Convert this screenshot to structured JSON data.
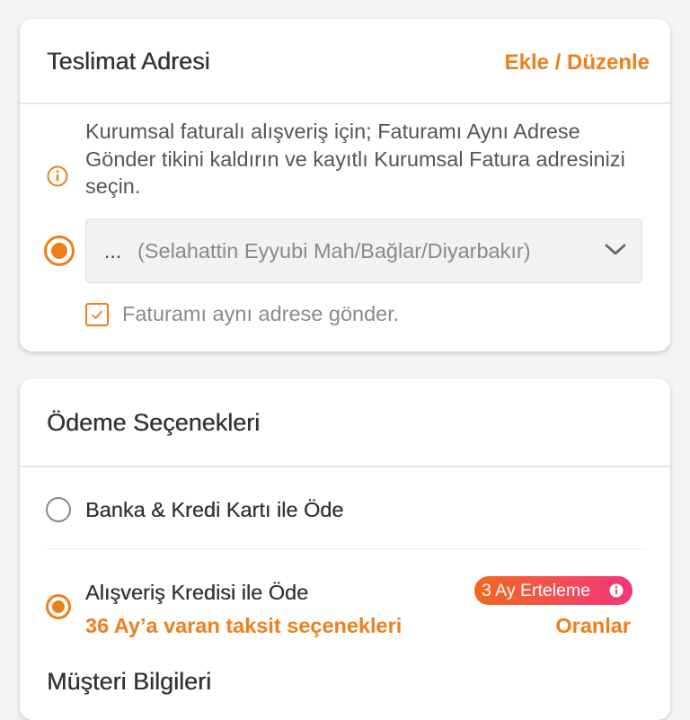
{
  "delivery": {
    "title": "Teslimat Adresi",
    "edit_label": "Ekle / Düzenle",
    "info_text": "Kurumsal faturalı alışveriş için; Faturamı Aynı Adrese Gönder tikini kaldırın ve kayıtlı Kurumsal Fatura adresinizi seçin.",
    "address_prefix": "...",
    "address_value": "(Selahattin Eyyubi Mah/Bağlar/Diyarbakır)",
    "same_address_label": "Faturamı aynı adrese gönder.",
    "same_address_checked": true
  },
  "payment": {
    "title": "Ödeme Seçenekleri",
    "options": [
      {
        "label": "Banka & Kredi Kartı ile Öde",
        "selected": false
      },
      {
        "label": "Alışveriş Kredisi ile Öde",
        "selected": true,
        "subtitle": "36 Ay’a varan taksit seçenekleri",
        "badge": "3 Ay Erteleme",
        "link": "Oranlar"
      }
    ]
  },
  "customer": {
    "title": "Müşteri Bilgileri"
  },
  "colors": {
    "accent": "#ef7f1a",
    "badge_end": "#f2367a"
  },
  "icons": [
    "info-icon",
    "chevron-down-icon",
    "check-icon",
    "info-badge-icon"
  ]
}
